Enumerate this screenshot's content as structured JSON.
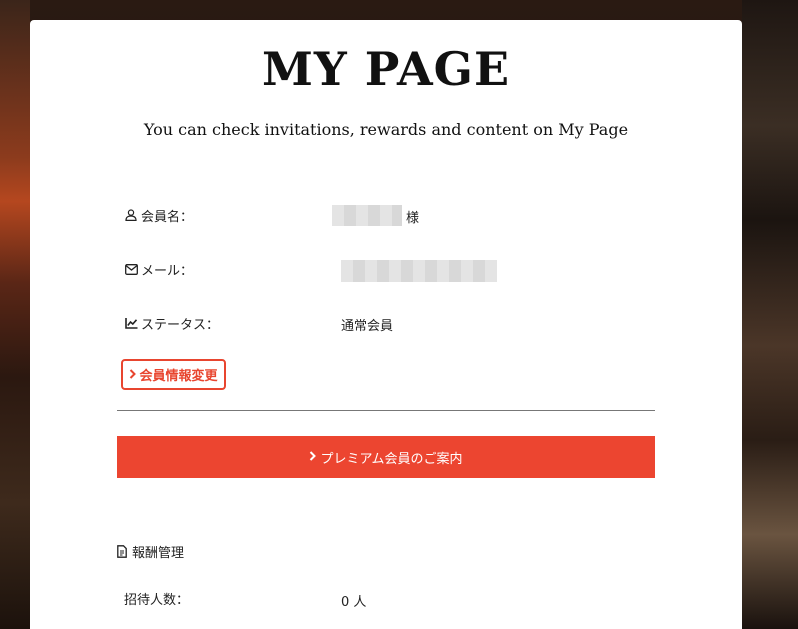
{
  "page": {
    "title": "MY PAGE",
    "subtitle": "You can check invitations, rewards and content on My Page"
  },
  "profile": {
    "member_name_label": "会員名：",
    "member_name_suffix": "様",
    "email_label": "メール：",
    "status_label": "ステータス：",
    "status_value": "通常会員"
  },
  "actions": {
    "edit_profile_label": "会員情報変更",
    "premium_label": "プレミアム会員のご案内"
  },
  "rewards": {
    "heading": "報酬管理",
    "invited_count_label": "招待人数：",
    "invited_count_value": "0 人"
  },
  "icons": {
    "member": "user-icon",
    "email": "envelope-icon",
    "status": "chart-line-icon",
    "edit": "chevron-right-icon",
    "premium": "chevron-right-icon",
    "rewards": "file-invoice-icon"
  },
  "colors": {
    "accent": "#ec4530",
    "text": "#222222",
    "card_bg": "#ffffff"
  }
}
